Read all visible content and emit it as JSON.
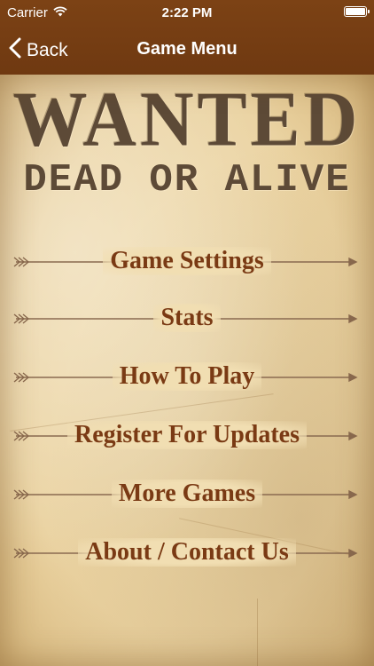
{
  "status_bar": {
    "carrier": "Carrier",
    "time": "2:22 PM"
  },
  "nav": {
    "back_label": "Back",
    "title": "Game Menu"
  },
  "poster": {
    "headline": "WANTED",
    "subline": "DEAD OR ALIVE"
  },
  "menu": {
    "items": [
      {
        "label": "Game Settings"
      },
      {
        "label": "Stats"
      },
      {
        "label": "How To Play"
      },
      {
        "label": "Register For Updates"
      },
      {
        "label": "More Games"
      },
      {
        "label": "About / Contact Us"
      }
    ]
  },
  "colors": {
    "header": "#7c4215",
    "menu_text": "#7a3a14",
    "poster_text": "#5d4a37",
    "paper": "#f1deb2"
  }
}
